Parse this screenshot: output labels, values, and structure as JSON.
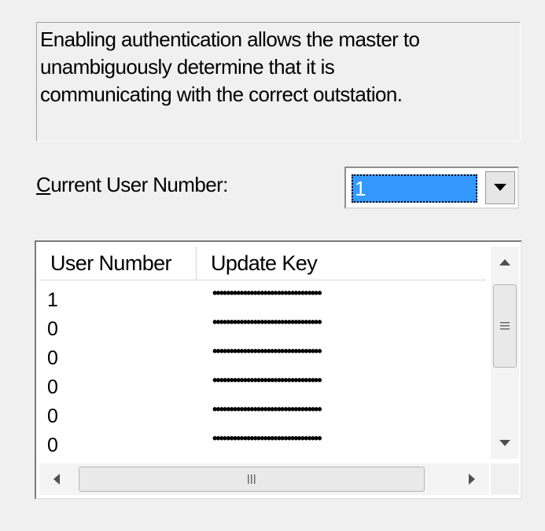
{
  "description": {
    "line1": "Enabling authentication allows the master to",
    "line2": "unambiguously determine that it is",
    "line3": "communicating with the correct outstation."
  },
  "current_user": {
    "label_mnemonic": "C",
    "label_rest": "urrent User Number:",
    "selected_value": "1"
  },
  "table": {
    "columns": [
      "User Number",
      "Update Key"
    ],
    "rows": [
      {
        "user_number": "1",
        "update_key": "••••••••••••••••••••••••••••••••"
      },
      {
        "user_number": "0",
        "update_key": "••••••••••••••••••••••••••••••••"
      },
      {
        "user_number": "0",
        "update_key": "••••••••••••••••••••••••••••••••"
      },
      {
        "user_number": "0",
        "update_key": "••••••••••••••••••••••••••••••••"
      },
      {
        "user_number": "0",
        "update_key": "••••••••••••••••••••••••••••••••"
      },
      {
        "user_number": "0",
        "update_key": "••••••••••••••••••••••••••••••••"
      }
    ]
  },
  "icons": {
    "dropdown": "chevron-down-icon",
    "scroll_up": "scroll-up-arrow-icon",
    "scroll_down": "scroll-down-arrow-icon",
    "scroll_left": "scroll-left-arrow-icon",
    "scroll_right": "scroll-right-arrow-icon",
    "grip": "grip-icon"
  },
  "colors": {
    "background": "#f0f0f0",
    "selection": "#3399ff"
  }
}
